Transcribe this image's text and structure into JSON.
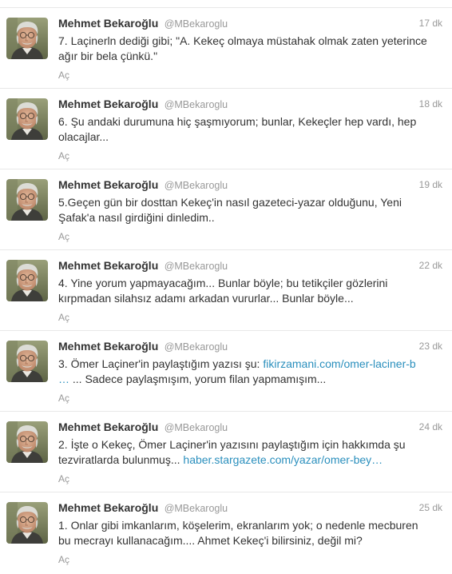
{
  "timeline": {
    "tweets": [
      {
        "fullname": "Mehmet Bekaroğlu",
        "username": "@MBekaroglu",
        "time": "17 dk",
        "line1": "7. Laçinerln dediği gibi; \"A. Kekeç olmaya müstahak olmak zaten yeterince",
        "line2": "ağır bir bela çünkü.\"",
        "expand": "Aç"
      },
      {
        "fullname": "Mehmet Bekaroğlu",
        "username": "@MBekaroglu",
        "time": "18 dk",
        "line1": "6. Şu andaki durumuna hiç şaşmıyorum; bunlar, Kekeçler hep vardı, hep",
        "line2": "olacajlar...",
        "expand": "Aç"
      },
      {
        "fullname": "Mehmet Bekaroğlu",
        "username": "@MBekaroglu",
        "time": "19 dk",
        "line1": "5.Geçen gün bir dosttan Kekeç'in nasıl gazeteci-yazar olduğunu, Yeni",
        "line2": "Şafak'a nasıl girdiğini dinledim..",
        "expand": "Aç"
      },
      {
        "fullname": "Mehmet Bekaroğlu",
        "username": "@MBekaroglu",
        "time": "22 dk",
        "line1": "4. Yine yorum yapmayacağım... Bunlar böyle; bu tetikçiler gözlerini",
        "line2": "kırpmadan silahsız adamı arkadan vururlar... Bunlar böyle...",
        "expand": "Aç"
      },
      {
        "fullname": "Mehmet Bekaroğlu",
        "username": "@MBekaroglu",
        "time": "23 dk",
        "line1": "3. Ömer Laçiner'in paylaştığım yazısı şu: ",
        "link1": "fikirzamani.com/omer-laciner-b",
        "link2": "…",
        "line2": " ... Sadece paylaşmışım, yorum filan yapmamışım...",
        "expand": "Aç"
      },
      {
        "fullname": "Mehmet Bekaroğlu",
        "username": "@MBekaroglu",
        "time": "24 dk",
        "line1": "2. İşte o Kekeç, Ömer Laçiner'in yazısını paylaştığım için hakkımda şu",
        "line2": "tezviratlarda bulunmuş... ",
        "link2": "haber.stargazete.com/yazar/omer-bey…",
        "expand": "Aç"
      },
      {
        "fullname": "Mehmet Bekaroğlu",
        "username": "@MBekaroglu",
        "time": "25 dk",
        "line1": "1. Onlar gibi imkanlarım, köşelerim, ekranlarım yok; o nedenle mecburen",
        "line2": "bu mecrayı kullanacağım.... Ahmet Kekeç'i bilirsiniz, değil mi?",
        "expand": "Aç"
      }
    ]
  }
}
